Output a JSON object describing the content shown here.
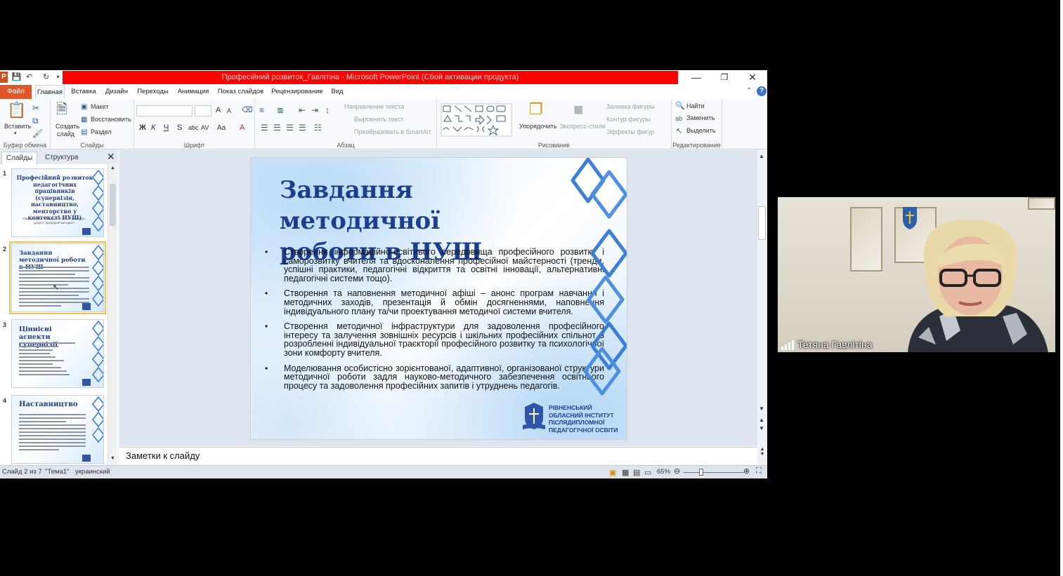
{
  "window": {
    "title": "Професійний розвиток_Гавлітіна - Microsoft PowerPoint (Сбой активации продукта)",
    "logo_letter": "P"
  },
  "tabs": {
    "file": "Файл",
    "items": [
      "Главная",
      "Вставка",
      "Дизайн",
      "Переходы",
      "Анимация",
      "Показ слайдов",
      "Рецензирование",
      "Вид"
    ],
    "active": "Главная"
  },
  "ribbon": {
    "clipboard": {
      "paste": "Вставить",
      "label": "Буфер обмена"
    },
    "slides": {
      "create": "Создать",
      "create2": "слайд",
      "layout": "Макет",
      "reset": "Восстановить",
      "section": "Раздел",
      "label": "Слайды"
    },
    "font": {
      "label": "Шрифт",
      "bold": "Ж",
      "italic": "К",
      "underline": "Ч",
      "strike": "S",
      "shadow": "abc",
      "spacing": "AV",
      "case": "Aa",
      "grow": "A",
      "shrink": "A",
      "color": "A"
    },
    "paragraph": {
      "label": "Абзац",
      "text_direction": "Направление текста",
      "align_text": "Выровнять текст",
      "smartart": "Преобразовать в SmartArt"
    },
    "drawing": {
      "label": "Рисование",
      "arrange": "Упорядочить",
      "quick_styles": "Экспресс-стили",
      "fill": "Заливка фигуры",
      "outline": "Контур фигуры",
      "effects": "Эффекты фигур"
    },
    "editing": {
      "label": "Редактирование",
      "find": "Найти",
      "replace": "Заменить",
      "select": "Выделить"
    }
  },
  "panel": {
    "tab_slides": "Слайды",
    "tab_outline": "Структура",
    "thumbnails": [
      {
        "num": "1",
        "title": "Професійний розвиток педагогічних працівників (супервізія, наставництво, менторство у контексті НУШ)",
        "subtitle": "Гавлітіна Т.М., кандидат педагогічних наук, доцент, провідний методист"
      },
      {
        "num": "2",
        "title": "Завдання методичної роботи в НУШ"
      },
      {
        "num": "3",
        "title": "Ціннісні аспекти супервізії"
      },
      {
        "num": "4",
        "title": "Наставництво"
      }
    ]
  },
  "slide": {
    "title_line1": "Завдання методичної",
    "title_line2": "роботи в НУШ",
    "bullets": [
      "Створення інформаційно-освітнього середовища професійного розвитку і саморозвитку вчителя та вдосконалення професійної майстерності (тренди, успішні практики, педагогічні відкриття та освітні інновації, альтернативні педагогічні системи тощо).",
      "Створення та наповнення методичної афіші – анонс програм навчання і методичних заходів, презентація й обмін досягненнями, наповнення індивідуального плану та/чи проектування методичої системи вчителя.",
      "Створення методичної інфраструктури для задоволення професійного інтересу та залучення зовнішніх ресурсів і шкільних професійних спільнот в розробленні індивідуальної траєкторії професійного розвитку та психологічної зони комфорту вчителя.",
      "Моделювання особистісно зорієнтованої, адаптивної, організованої структури методичної роботи задля науково-методичного забезпечення освітнього процесу та задоволення професійних запитів і утруднень педагогів."
    ],
    "logo_text": "РІВНЕНСЬКИЙ ОБЛАСНИЙ ІНСТИТУТ ПІСЛЯДИПЛОМНОЇ ПЕДАГОГІЧНОЇ ОСВІТИ"
  },
  "notes": {
    "placeholder": "Заметки к слайду"
  },
  "status": {
    "slide_of": "Слайд 2 из 7",
    "theme": "\"Тема1\"",
    "language": "украинский",
    "zoom": "65%"
  },
  "video": {
    "name": "Тетяна Гавлітіна"
  },
  "colors": {
    "title_red": "#ff0000",
    "slide_title": "#1c3e91",
    "file_tab": "#e0562a"
  }
}
